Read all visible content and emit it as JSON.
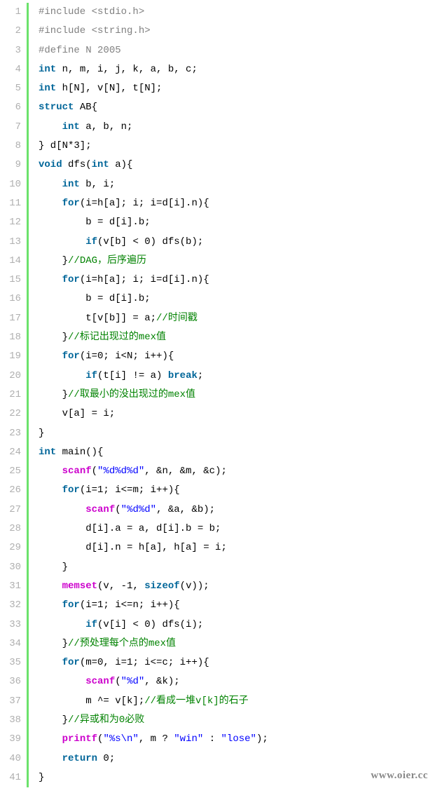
{
  "watermark": "www.oier.cc",
  "lines": [
    {
      "n": "1",
      "tokens": [
        [
          "pre",
          "#include <stdio.h>"
        ]
      ]
    },
    {
      "n": "2",
      "tokens": [
        [
          "pre",
          "#include <string.h>"
        ]
      ]
    },
    {
      "n": "3",
      "tokens": [
        [
          "pre",
          "#define N 2005"
        ]
      ]
    },
    {
      "n": "4",
      "tokens": [
        [
          "kw",
          "int"
        ],
        [
          "plain",
          " n, m, i, j, k, a, b, c;"
        ]
      ]
    },
    {
      "n": "5",
      "tokens": [
        [
          "kw",
          "int"
        ],
        [
          "plain",
          " h[N], v[N], t[N];"
        ]
      ]
    },
    {
      "n": "6",
      "tokens": [
        [
          "kw",
          "struct"
        ],
        [
          "plain",
          " AB{"
        ]
      ]
    },
    {
      "n": "7",
      "tokens": [
        [
          "plain",
          "    "
        ],
        [
          "kw",
          "int"
        ],
        [
          "plain",
          " a, b, n;"
        ]
      ]
    },
    {
      "n": "8",
      "tokens": [
        [
          "plain",
          "} d[N*3];"
        ]
      ]
    },
    {
      "n": "9",
      "tokens": [
        [
          "kw",
          "void"
        ],
        [
          "plain",
          " dfs("
        ],
        [
          "kw",
          "int"
        ],
        [
          "plain",
          " a){"
        ]
      ]
    },
    {
      "n": "10",
      "tokens": [
        [
          "plain",
          "    "
        ],
        [
          "kw",
          "int"
        ],
        [
          "plain",
          " b, i;"
        ]
      ]
    },
    {
      "n": "11",
      "tokens": [
        [
          "plain",
          "    "
        ],
        [
          "kw",
          "for"
        ],
        [
          "plain",
          "(i=h[a]; i; i=d[i].n){"
        ]
      ]
    },
    {
      "n": "12",
      "tokens": [
        [
          "plain",
          "        b = d[i].b;"
        ]
      ]
    },
    {
      "n": "13",
      "tokens": [
        [
          "plain",
          "        "
        ],
        [
          "kw",
          "if"
        ],
        [
          "plain",
          "(v[b] < 0) dfs(b);"
        ]
      ]
    },
    {
      "n": "14",
      "tokens": [
        [
          "plain",
          "    }"
        ],
        [
          "cmt",
          "//DAG，后序遍历"
        ]
      ]
    },
    {
      "n": "15",
      "tokens": [
        [
          "plain",
          "    "
        ],
        [
          "kw",
          "for"
        ],
        [
          "plain",
          "(i=h[a]; i; i=d[i].n){"
        ]
      ]
    },
    {
      "n": "16",
      "tokens": [
        [
          "plain",
          "        b = d[i].b;"
        ]
      ]
    },
    {
      "n": "17",
      "tokens": [
        [
          "plain",
          "        t[v[b]] = a;"
        ],
        [
          "cmt",
          "//时间戳"
        ]
      ]
    },
    {
      "n": "18",
      "tokens": [
        [
          "plain",
          "    }"
        ],
        [
          "cmt",
          "//标记出现过的mex值"
        ]
      ]
    },
    {
      "n": "19",
      "tokens": [
        [
          "plain",
          "    "
        ],
        [
          "kw",
          "for"
        ],
        [
          "plain",
          "(i=0; i<N; i++){"
        ]
      ]
    },
    {
      "n": "20",
      "tokens": [
        [
          "plain",
          "        "
        ],
        [
          "kw",
          "if"
        ],
        [
          "plain",
          "(t[i] != a) "
        ],
        [
          "kw",
          "break"
        ],
        [
          "plain",
          ";"
        ]
      ]
    },
    {
      "n": "21",
      "tokens": [
        [
          "plain",
          "    }"
        ],
        [
          "cmt",
          "//取最小的没出现过的mex值"
        ]
      ]
    },
    {
      "n": "22",
      "tokens": [
        [
          "plain",
          "    v[a] = i;"
        ]
      ]
    },
    {
      "n": "23",
      "tokens": [
        [
          "plain",
          "}"
        ]
      ]
    },
    {
      "n": "24",
      "tokens": [
        [
          "kw",
          "int"
        ],
        [
          "plain",
          " main(){"
        ]
      ]
    },
    {
      "n": "25",
      "tokens": [
        [
          "plain",
          "    "
        ],
        [
          "fn",
          "scanf"
        ],
        [
          "plain",
          "("
        ],
        [
          "str",
          "\"%d%d%d\""
        ],
        [
          "plain",
          ", &n, &m, &c);"
        ]
      ]
    },
    {
      "n": "26",
      "tokens": [
        [
          "plain",
          "    "
        ],
        [
          "kw",
          "for"
        ],
        [
          "plain",
          "(i=1; i<=m; i++){"
        ]
      ]
    },
    {
      "n": "27",
      "tokens": [
        [
          "plain",
          "        "
        ],
        [
          "fn",
          "scanf"
        ],
        [
          "plain",
          "("
        ],
        [
          "str",
          "\"%d%d\""
        ],
        [
          "plain",
          ", &a, &b);"
        ]
      ]
    },
    {
      "n": "28",
      "tokens": [
        [
          "plain",
          "        d[i].a = a, d[i].b = b;"
        ]
      ]
    },
    {
      "n": "29",
      "tokens": [
        [
          "plain",
          "        d[i].n = h[a], h[a] = i;"
        ]
      ]
    },
    {
      "n": "30",
      "tokens": [
        [
          "plain",
          "    }"
        ]
      ]
    },
    {
      "n": "31",
      "tokens": [
        [
          "plain",
          "    "
        ],
        [
          "fn",
          "memset"
        ],
        [
          "plain",
          "(v, -1, "
        ],
        [
          "kw",
          "sizeof"
        ],
        [
          "plain",
          "(v));"
        ]
      ]
    },
    {
      "n": "32",
      "tokens": [
        [
          "plain",
          "    "
        ],
        [
          "kw",
          "for"
        ],
        [
          "plain",
          "(i=1; i<=n; i++){"
        ]
      ]
    },
    {
      "n": "33",
      "tokens": [
        [
          "plain",
          "        "
        ],
        [
          "kw",
          "if"
        ],
        [
          "plain",
          "(v[i] < 0) dfs(i);"
        ]
      ]
    },
    {
      "n": "34",
      "tokens": [
        [
          "plain",
          "    }"
        ],
        [
          "cmt",
          "//预处理每个点的mex值"
        ]
      ]
    },
    {
      "n": "35",
      "tokens": [
        [
          "plain",
          "    "
        ],
        [
          "kw",
          "for"
        ],
        [
          "plain",
          "(m=0, i=1; i<=c; i++){"
        ]
      ]
    },
    {
      "n": "36",
      "tokens": [
        [
          "plain",
          "        "
        ],
        [
          "fn",
          "scanf"
        ],
        [
          "plain",
          "("
        ],
        [
          "str",
          "\"%d\""
        ],
        [
          "plain",
          ", &k);"
        ]
      ]
    },
    {
      "n": "37",
      "tokens": [
        [
          "plain",
          "        m ^= v[k];"
        ],
        [
          "cmt",
          "//看成一堆v[k]的石子"
        ]
      ]
    },
    {
      "n": "38",
      "tokens": [
        [
          "plain",
          "    }"
        ],
        [
          "cmt",
          "//异或和为0必败"
        ]
      ]
    },
    {
      "n": "39",
      "tokens": [
        [
          "plain",
          "    "
        ],
        [
          "fn",
          "printf"
        ],
        [
          "plain",
          "("
        ],
        [
          "str",
          "\"%s\\n\""
        ],
        [
          "plain",
          ", m ? "
        ],
        [
          "str",
          "\"win\""
        ],
        [
          "plain",
          " : "
        ],
        [
          "str",
          "\"lose\""
        ],
        [
          "plain",
          ");"
        ]
      ]
    },
    {
      "n": "40",
      "tokens": [
        [
          "plain",
          "    "
        ],
        [
          "kw",
          "return"
        ],
        [
          "plain",
          " 0;"
        ]
      ]
    },
    {
      "n": "41",
      "tokens": [
        [
          "plain",
          "}"
        ]
      ]
    }
  ]
}
